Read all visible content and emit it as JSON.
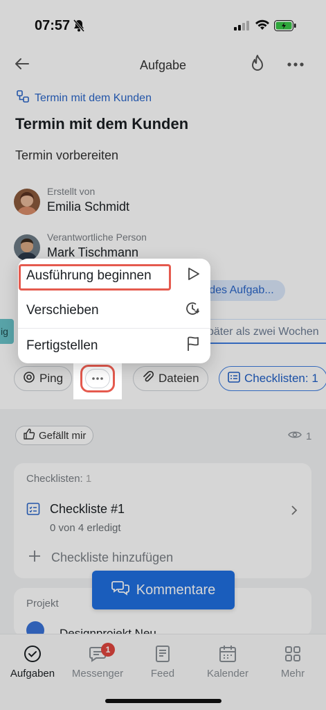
{
  "status_bar": {
    "time": "07:57"
  },
  "nav": {
    "title": "Aufgabe"
  },
  "task": {
    "parent_link": "Termin mit dem Kunden",
    "title": "Termin mit dem Kunden",
    "description": "Termin vorbereiten"
  },
  "people": [
    {
      "role": "Erstellt von",
      "name": "Emilia Schmidt"
    },
    {
      "role": "Verantwortliche Person",
      "name": "Mark Tischmann"
    }
  ],
  "partial_chip": "ng des Aufgab...",
  "deadline_partial": "päter als zwei Wochen",
  "left_tag": "ig",
  "actions": {
    "ping": "Ping",
    "files": "Dateien",
    "checklists": "Checklisten: 1"
  },
  "popup_menu": {
    "items": [
      {
        "label": "Ausführung beginnen",
        "icon": "play-icon"
      },
      {
        "label": "Verschieben",
        "icon": "clock-forward-icon"
      },
      {
        "label": "Fertigstellen",
        "icon": "flag-icon"
      }
    ]
  },
  "like": {
    "label": "Gefällt mir",
    "views": "1"
  },
  "checklists_card": {
    "label": "Checklisten:",
    "count": "1",
    "item_title": "Checkliste #1",
    "item_progress": "0 von 4 erledigt",
    "add_label": "Checkliste hinzufügen"
  },
  "project_card": {
    "label": "Projekt",
    "name": "Designprojekt Neu"
  },
  "comments_button": "Kommentare",
  "tabbar": {
    "items": [
      {
        "label": "Aufgaben",
        "active": true
      },
      {
        "label": "Messenger",
        "badge": "1"
      },
      {
        "label": "Feed"
      },
      {
        "label": "Kalender"
      },
      {
        "label": "Mehr"
      }
    ]
  },
  "colors": {
    "accent": "#1f6fe0",
    "highlight": "#e55a4e",
    "badge": "#e0463f"
  }
}
